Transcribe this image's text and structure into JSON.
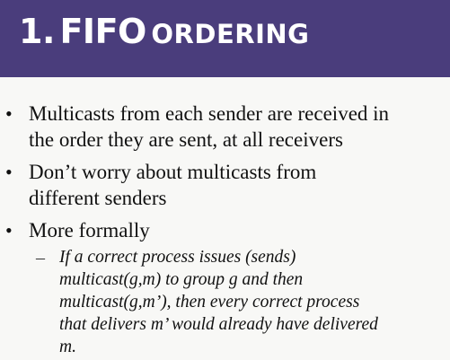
{
  "slide": {
    "title_number": "1.",
    "title_acronym": "FIFO",
    "title_word": "ORDERING",
    "header_color": "#4a3d7c",
    "bullets": [
      {
        "marker": "•",
        "text": "Multicasts from each sender are received in\nthe order they are sent, at all receivers"
      },
      {
        "marker": "•",
        "text": "Don’t worry about multicasts from\ndifferent senders"
      },
      {
        "marker": "•",
        "text": "More formally"
      }
    ],
    "sub_bullet": {
      "marker": "–",
      "text": "If a correct process issues (sends)\nmulticast(g,m) to group g and then\nmulticast(g,m’), then every correct    process\nthat delivers m’ would already have delivered\nm."
    }
  }
}
